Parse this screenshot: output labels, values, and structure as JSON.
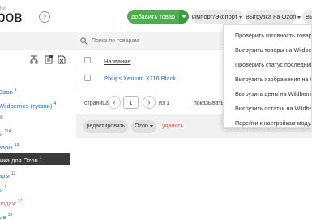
{
  "header": {
    "title": "ров",
    "help": "?",
    "add_button": "добавить товар",
    "import_export": "Импорт/Экспорт",
    "ozon_export": "Выгрузка на Ozon",
    "wb_export": "Вы"
  },
  "sidebar": {
    "head_text": "вы",
    "items": [
      {
        "label": "Ozon",
        "count": "1"
      },
      {
        "label": "Wildberries (туфли)",
        "count": "4"
      },
      {
        "label": "",
        "count": "30"
      },
      {
        "label": "ы",
        "count": "114"
      },
      {
        "label": "вары",
        "count": "13"
      },
      {
        "label": "ика для Ozon",
        "count": "1"
      },
      {
        "label": "ары",
        "count": "12"
      },
      {
        "label": "ы",
        "count": "9"
      },
      {
        "label": "родаж",
        "count": "17"
      },
      {
        "label": "ые",
        "count": "10"
      }
    ]
  },
  "search": {
    "placeholder": "Поиск по товарам"
  },
  "table": {
    "column_name": "Название",
    "rows": [
      {
        "name": "Philips Xenium X116 Black"
      }
    ]
  },
  "pagination": {
    "page_label": "страница",
    "prev": "‹",
    "current": "1",
    "next": "›",
    "of_label": "из 1",
    "per_page_label": "показывать по"
  },
  "bulk": {
    "edit": "редактировать",
    "ozon": "Ozon",
    "delete": "удалить"
  },
  "dropdown": {
    "items": [
      "Проверить готовность товаров",
      "Выгрузить товары на Wildberries",
      "Проверить статус последний вы",
      "Выгрузить изображения на Wildb",
      "Выгрузить цены на Wildberries",
      "Выгрузить остатки на Wildberrie",
      "Перейти к настройкам модуля W"
    ]
  },
  "colors": {
    "accent_green": "#4cae4c",
    "link_blue": "#2a6db5",
    "danger_red": "#d9534f",
    "active_dark": "#3a3a3a"
  }
}
